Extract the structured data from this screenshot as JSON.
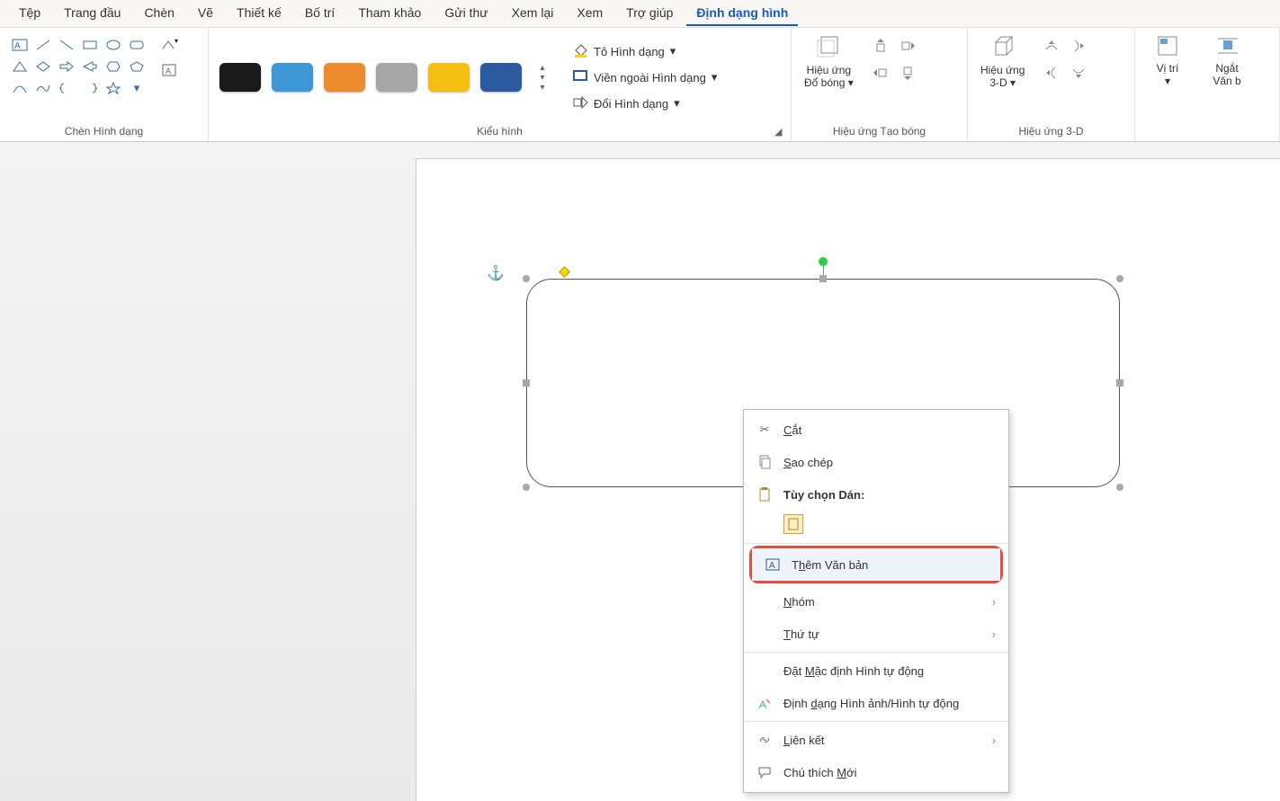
{
  "menubar": {
    "items": [
      {
        "label": "Tệp"
      },
      {
        "label": "Trang đầu"
      },
      {
        "label": "Chèn"
      },
      {
        "label": "Vẽ"
      },
      {
        "label": "Thiết kế"
      },
      {
        "label": "Bố trí"
      },
      {
        "label": "Tham khảo"
      },
      {
        "label": "Gửi thư"
      },
      {
        "label": "Xem lại"
      },
      {
        "label": "Xem"
      },
      {
        "label": "Trợ giúp"
      },
      {
        "label": "Định dạng hình",
        "active": true
      }
    ]
  },
  "ribbon": {
    "insert_shapes": {
      "label": "Chèn Hình dạng"
    },
    "shape_styles": {
      "label": "Kiểu hình",
      "colors": [
        "#1a1a1a",
        "#3d97d4",
        "#ed8a2d",
        "#a6a6a6",
        "#f5bf12",
        "#2c5aa0"
      ],
      "fill": "Tô Hình dạng",
      "outline": "Viền ngoài Hình dạng",
      "change": "Đổi Hình dạng"
    },
    "shadow": {
      "label": "Hiệu ứng Tạo bóng",
      "button": "Hiệu ứng\nĐổ bóng"
    },
    "threeD": {
      "label": "Hiệu ứng 3-D",
      "button": "Hiệu ứng\n3-D"
    },
    "arrange": {
      "position": "Vị trí",
      "wrap": "Ngắt\nVăn b"
    }
  },
  "context_menu": {
    "cut": "Cắt",
    "copy": "Sao chép",
    "paste_opts": "Tùy chọn Dán:",
    "add_text": "Thêm Văn bản",
    "group": "Nhóm",
    "order": "Thứ tự",
    "set_default": "Đặt Mặc định Hình tự động",
    "format": "Định dạng Hình ảnh/Hình tự động",
    "link": "Liên kết",
    "new_comment": "Chú thích Mới"
  }
}
